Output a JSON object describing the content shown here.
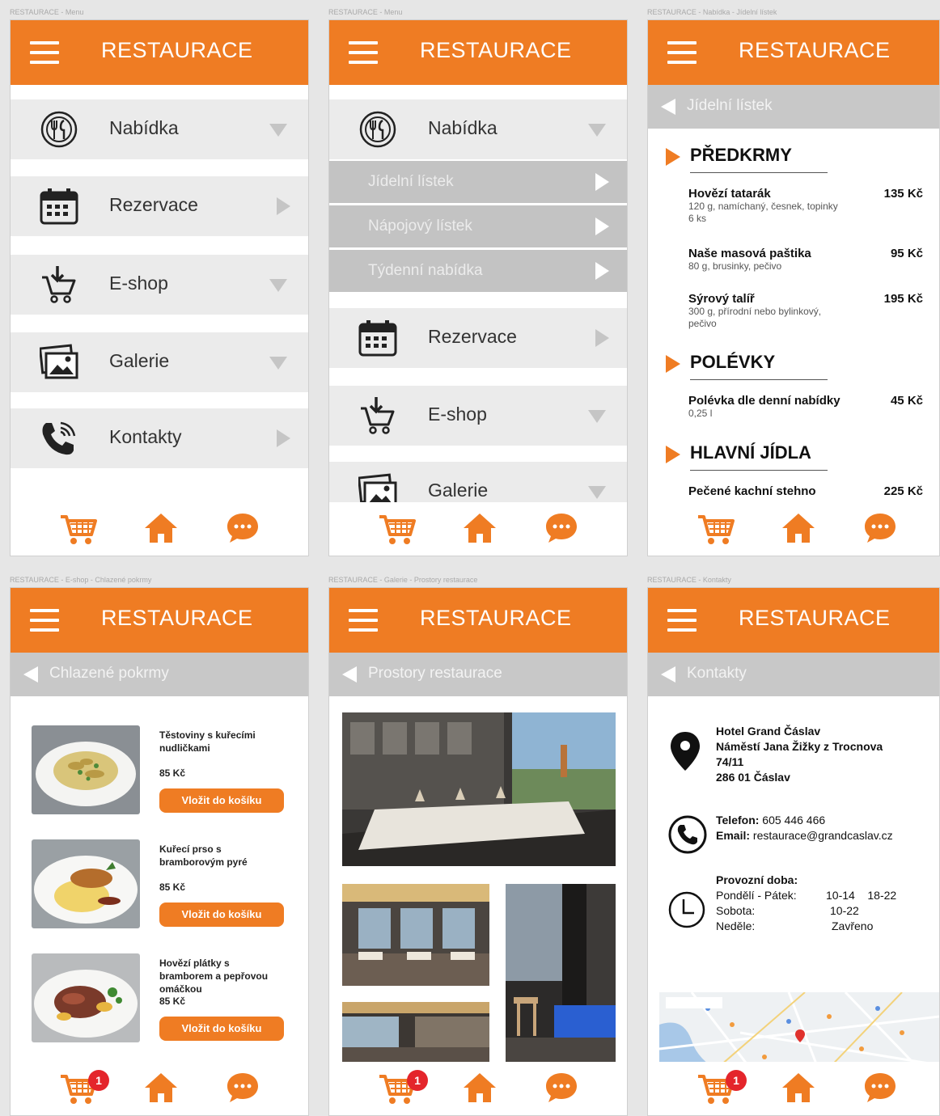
{
  "colors": {
    "accent": "#ef7c23",
    "badge": "#e4252b",
    "row": "#ebebeb",
    "subrow": "#c3c3c3"
  },
  "app": {
    "title": "RESTAURACE"
  },
  "frames": [
    {
      "label": "RESTAURACE - Menu"
    },
    {
      "label": "RESTAURACE - Menu"
    },
    {
      "label": "RESTAURACE - Nabídka - Jídelní lístek"
    },
    {
      "label": "RESTAURACE - E-shop - Chlazené pokrmy"
    },
    {
      "label": "RESTAURACE - Galerie - Prostory restaurace"
    },
    {
      "label": "RESTAURACE - Kontakty"
    }
  ],
  "menu": {
    "items": [
      {
        "label": "Nabídka",
        "icon": "cutlery-icon"
      },
      {
        "label": "Rezervace",
        "icon": "calendar-icon"
      },
      {
        "label": "E-shop",
        "icon": "cart-icon"
      },
      {
        "label": "Galerie",
        "icon": "gallery-icon"
      },
      {
        "label": "Kontakty",
        "icon": "phone-icon"
      }
    ],
    "submenu": [
      "Jídelní lístek",
      "Nápojový lístek",
      "Týdenní nabídka"
    ]
  },
  "jidelni": {
    "subtitle": "Jídelní lístek",
    "categories": [
      "PŘEDKRMY",
      "POLÉVKY",
      "HLAVNÍ JÍDLA"
    ],
    "dishes": [
      {
        "name": "Hovězí tatarák",
        "desc": "120 g, namíchaný, česnek, topinky 6 ks",
        "price": "135 Kč"
      },
      {
        "name": "Naše masová paštika",
        "desc": "80 g, brusinky, pečivo",
        "price": "95 Kč"
      },
      {
        "name": "Sýrový talíř",
        "desc": "300 g, přírodní nebo bylinkový, pečivo",
        "price": "195 Kč"
      },
      {
        "name": "Polévka dle denní nabídky",
        "desc": "0,25 l",
        "price": "45 Kč"
      },
      {
        "name": "Pečené kachní stehno",
        "desc": "",
        "price": "225 Kč"
      }
    ]
  },
  "eshop": {
    "subtitle": "Chlazené pokrmy",
    "button": "Vložit do košíku",
    "cart_count": "1",
    "products": [
      {
        "name": "Těstoviny s kuřecími nudličkami",
        "price": "85 Kč"
      },
      {
        "name": "Kuřecí prso s bramborovým pyré",
        "price": "85 Kč"
      },
      {
        "name": "Hovězí plátky s bramborem a pepřovou omáčkou",
        "price": "85 Kč"
      }
    ]
  },
  "galerie": {
    "subtitle": "Prostory restaurace"
  },
  "kontakty": {
    "subtitle": "Kontakty",
    "address": [
      "Hotel Grand Čáslav",
      "Náměstí Jana Žižky z Trocnova",
      "74/11",
      "286 01 Čáslav"
    ],
    "phone_label": "Telefon:",
    "phone": "605 446 466",
    "email_label": "Email:",
    "email": "restaurace@grandcaslav.cz",
    "hours_title": "Provozní doba:",
    "hours": [
      {
        "day": "Pondělí - Pátek:",
        "time": "10-14    18-22"
      },
      {
        "day": "Sobota:",
        "time": "10-22"
      },
      {
        "day": "Neděle:",
        "time": "Zavřeno"
      }
    ]
  }
}
